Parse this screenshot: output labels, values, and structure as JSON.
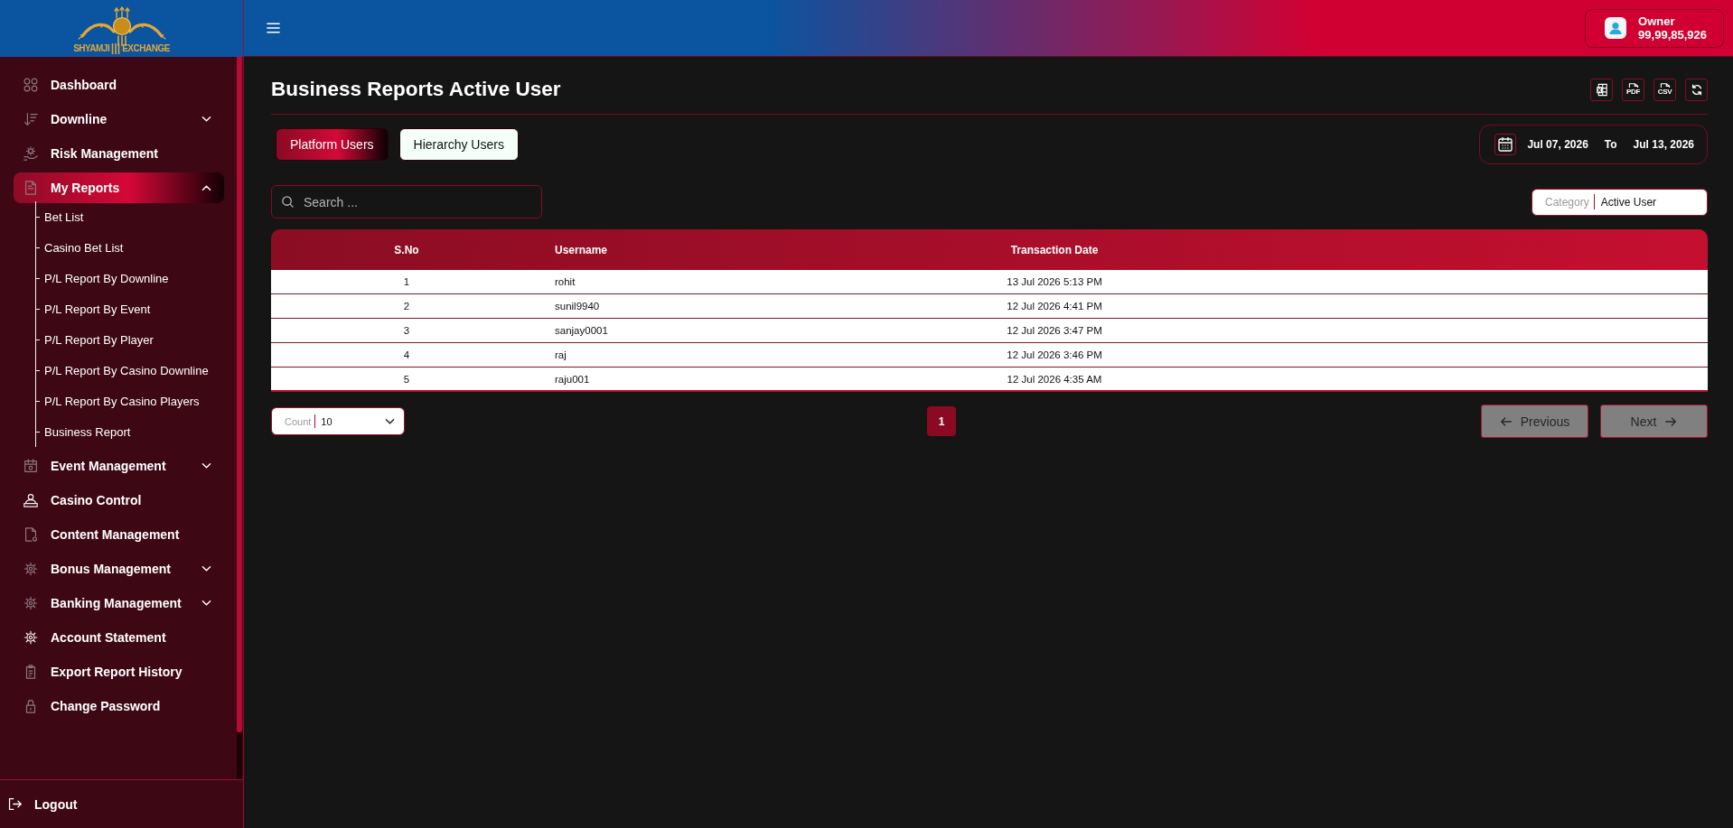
{
  "logo": {
    "words": [
      "SHYAMJI",
      "EXCHANGE"
    ]
  },
  "sidebar": {
    "items": [
      {
        "label": "Dashboard",
        "kind": "link",
        "selected": false
      },
      {
        "label": "Downline",
        "kind": "group",
        "expanded": false,
        "selected": false
      },
      {
        "label": "Risk Management",
        "kind": "link",
        "selected": false
      },
      {
        "label": "My Reports",
        "kind": "group",
        "expanded": true,
        "selected": true,
        "children": [
          {
            "label": "Bet List",
            "selected": false
          },
          {
            "label": "Casino Bet List",
            "selected": false
          },
          {
            "label": "P/L Report By Downline",
            "selected": false
          },
          {
            "label": "P/L Report By Event",
            "selected": false
          },
          {
            "label": "P/L Report By Player",
            "selected": false
          },
          {
            "label": "P/L Report By Casino Downline",
            "selected": false
          },
          {
            "label": "P/L Report By Casino Players",
            "selected": false
          },
          {
            "label": "Business Report",
            "selected": false
          }
        ]
      },
      {
        "label": "Event Management",
        "kind": "group",
        "expanded": false,
        "selected": false
      },
      {
        "label": "Casino Control",
        "kind": "link",
        "selected": false
      },
      {
        "label": "Content Management",
        "kind": "link",
        "selected": false
      },
      {
        "label": "Bonus Management",
        "kind": "group",
        "expanded": false,
        "selected": false
      },
      {
        "label": "Banking Management",
        "kind": "group",
        "expanded": false,
        "selected": false
      },
      {
        "label": "Account Statement",
        "kind": "link",
        "selected": false
      },
      {
        "label": "Export Report History",
        "kind": "link",
        "selected": false
      },
      {
        "label": "Change Password",
        "kind": "link",
        "selected": false
      }
    ],
    "logout": "Logout"
  },
  "topbar": {
    "user": {
      "role": "Owner",
      "balance": "99,99,85,926"
    }
  },
  "page": {
    "title": "Business Reports Active User",
    "export_buttons": [
      {
        "kind": "excel"
      },
      {
        "kind": "pdf",
        "label": "PDF"
      },
      {
        "kind": "csv",
        "label": "CSV"
      },
      {
        "kind": "refresh"
      }
    ]
  },
  "tabs": [
    {
      "label": "Platform Users",
      "selected": true
    },
    {
      "label": "Hierarchy Users",
      "selected": false
    }
  ],
  "date_range": {
    "from": "Jul 07, 2026",
    "separator": "To",
    "to": "Jul 13, 2026"
  },
  "search": {
    "placeholder": "Search ..."
  },
  "category": {
    "label": "Category",
    "value": "Active User"
  },
  "table": {
    "columns": [
      "S.No",
      "Username",
      "Transaction Date"
    ],
    "rows": [
      [
        "1",
        "rohit",
        "13 Jul 2026 5:13 PM"
      ],
      [
        "2",
        "sunil9940",
        "12 Jul 2026 4:41 PM"
      ],
      [
        "3",
        "sanjay0001",
        "12 Jul 2026 3:47 PM"
      ],
      [
        "4",
        "raj",
        "12 Jul 2026 3:46 PM"
      ],
      [
        "5",
        "raju001",
        "12 Jul 2026 4:35 AM"
      ]
    ]
  },
  "pagination": {
    "count": {
      "label": "Count",
      "value": "10"
    },
    "pages": [
      {
        "label": "1",
        "selected": true
      }
    ],
    "previous": {
      "label": "Previous",
      "disabled": true
    },
    "next": {
      "label": "Next",
      "disabled": true
    }
  }
}
